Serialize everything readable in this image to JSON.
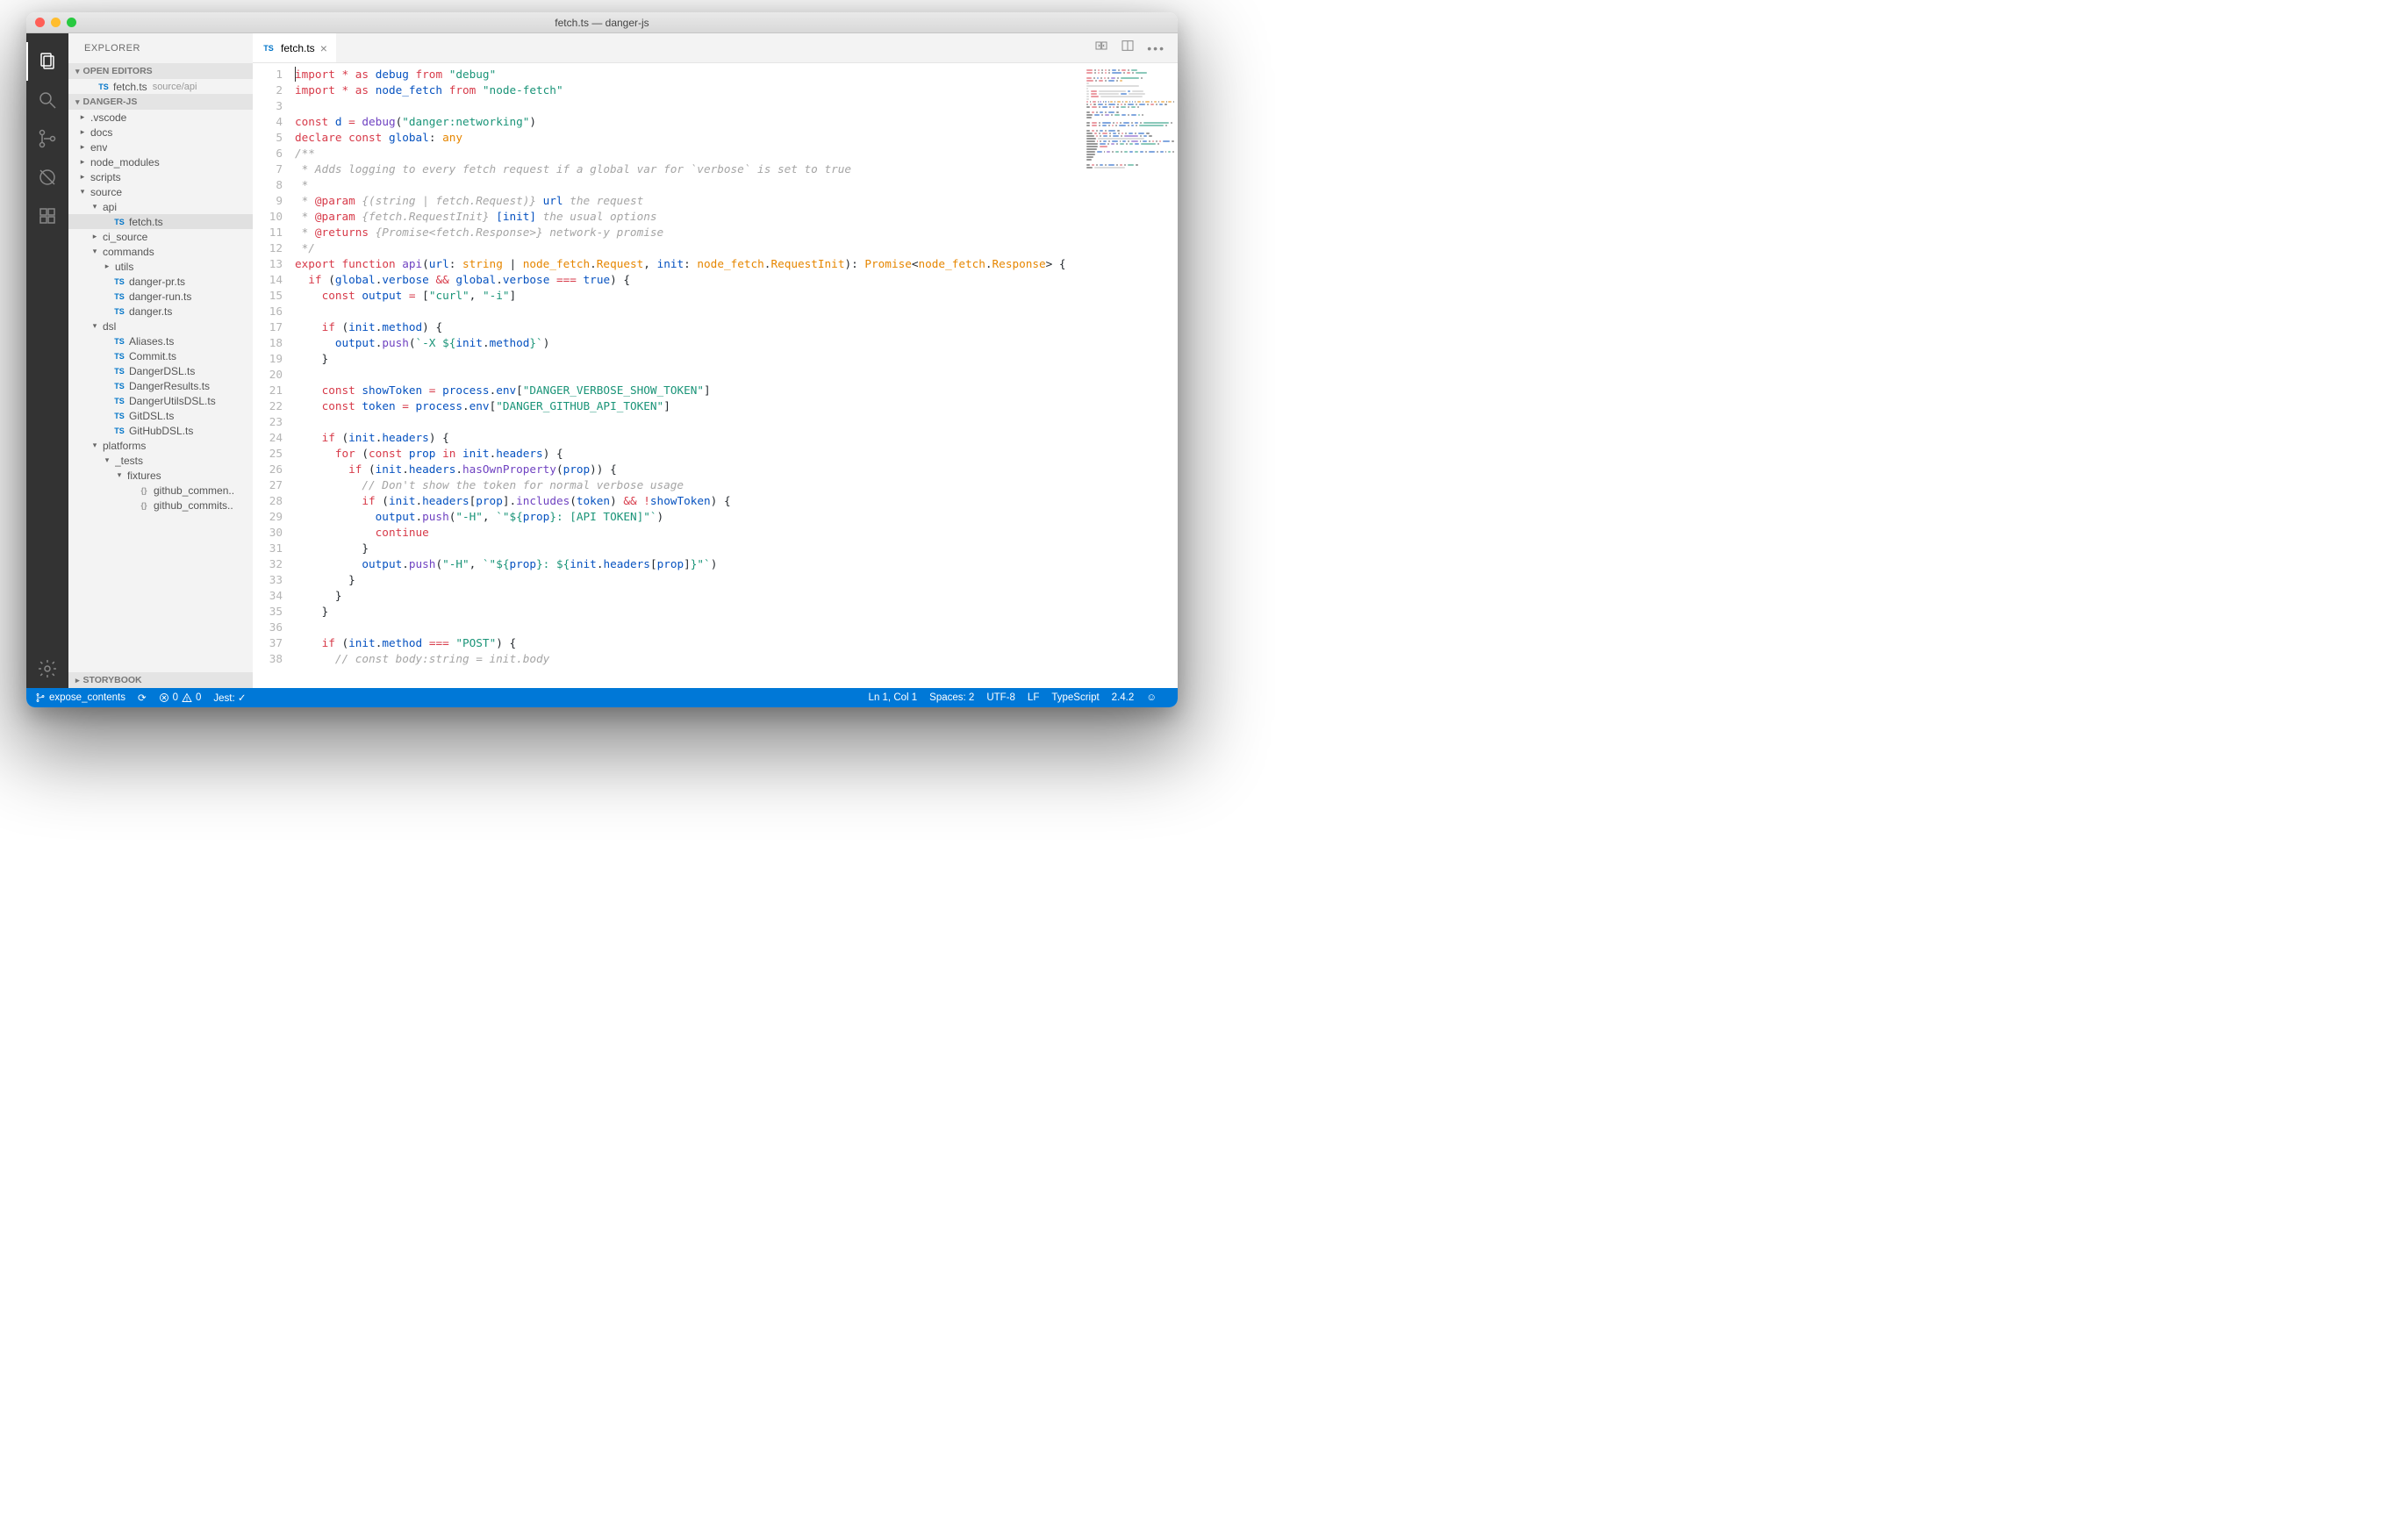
{
  "window_title": "fetch.ts — danger-js",
  "activity_icons": [
    "files",
    "search",
    "git",
    "debug",
    "extensions"
  ],
  "explorer": {
    "title": "EXPLORER",
    "open_editors": {
      "label": "OPEN EDITORS",
      "items": [
        {
          "icon": "TS",
          "name": "fetch.ts",
          "detail": "source/api"
        }
      ]
    },
    "workspace": {
      "label": "DANGER-JS",
      "tree": [
        {
          "d": 0,
          "t": "folder",
          "open": false,
          "name": ".vscode"
        },
        {
          "d": 0,
          "t": "folder",
          "open": false,
          "name": "docs"
        },
        {
          "d": 0,
          "t": "folder",
          "open": false,
          "name": "env"
        },
        {
          "d": 0,
          "t": "folder",
          "open": false,
          "name": "node_modules"
        },
        {
          "d": 0,
          "t": "folder",
          "open": false,
          "name": "scripts"
        },
        {
          "d": 0,
          "t": "folder",
          "open": true,
          "name": "source"
        },
        {
          "d": 1,
          "t": "folder",
          "open": true,
          "name": "api"
        },
        {
          "d": 2,
          "t": "file",
          "icon": "TS",
          "name": "fetch.ts",
          "sel": true
        },
        {
          "d": 1,
          "t": "folder",
          "open": false,
          "name": "ci_source"
        },
        {
          "d": 1,
          "t": "folder",
          "open": true,
          "name": "commands"
        },
        {
          "d": 2,
          "t": "folder",
          "open": false,
          "name": "utils"
        },
        {
          "d": 2,
          "t": "file",
          "icon": "TS",
          "name": "danger-pr.ts"
        },
        {
          "d": 2,
          "t": "file",
          "icon": "TS",
          "name": "danger-run.ts"
        },
        {
          "d": 2,
          "t": "file",
          "icon": "TS",
          "name": "danger.ts"
        },
        {
          "d": 1,
          "t": "folder",
          "open": true,
          "name": "dsl"
        },
        {
          "d": 2,
          "t": "file",
          "icon": "TS",
          "name": "Aliases.ts"
        },
        {
          "d": 2,
          "t": "file",
          "icon": "TS",
          "name": "Commit.ts"
        },
        {
          "d": 2,
          "t": "file",
          "icon": "TS",
          "name": "DangerDSL.ts"
        },
        {
          "d": 2,
          "t": "file",
          "icon": "TS",
          "name": "DangerResults.ts"
        },
        {
          "d": 2,
          "t": "file",
          "icon": "TS",
          "name": "DangerUtilsDSL.ts"
        },
        {
          "d": 2,
          "t": "file",
          "icon": "TS",
          "name": "GitDSL.ts"
        },
        {
          "d": 2,
          "t": "file",
          "icon": "TS",
          "name": "GitHubDSL.ts"
        },
        {
          "d": 1,
          "t": "folder",
          "open": true,
          "name": "platforms"
        },
        {
          "d": 2,
          "t": "folder",
          "open": true,
          "name": "_tests"
        },
        {
          "d": 3,
          "t": "folder",
          "open": true,
          "name": "fixtures"
        },
        {
          "d": 4,
          "t": "file",
          "icon": "{}",
          "name": "github_commen.."
        },
        {
          "d": 4,
          "t": "file",
          "icon": "{}",
          "name": "github_commits.."
        }
      ]
    },
    "storybook_label": "STORYBOOK"
  },
  "tab": {
    "icon": "TS",
    "name": "fetch.ts"
  },
  "code_lines": [
    [
      [
        "k",
        "import"
      ],
      [
        "v",
        " "
      ],
      [
        "o",
        "*"
      ],
      [
        "v",
        " "
      ],
      [
        "k",
        "as"
      ],
      [
        "v",
        " "
      ],
      [
        "p",
        "debug"
      ],
      [
        "v",
        " "
      ],
      [
        "k",
        "from"
      ],
      [
        "v",
        " "
      ],
      [
        "s",
        "\"debug\""
      ]
    ],
    [
      [
        "k",
        "import"
      ],
      [
        "v",
        " "
      ],
      [
        "o",
        "*"
      ],
      [
        "v",
        " "
      ],
      [
        "k",
        "as"
      ],
      [
        "v",
        " "
      ],
      [
        "p",
        "node_fetch"
      ],
      [
        "v",
        " "
      ],
      [
        "k",
        "from"
      ],
      [
        "v",
        " "
      ],
      [
        "s",
        "\"node-fetch\""
      ]
    ],
    [],
    [
      [
        "k",
        "const"
      ],
      [
        "v",
        " "
      ],
      [
        "p",
        "d"
      ],
      [
        "v",
        " "
      ],
      [
        "o",
        "="
      ],
      [
        "v",
        " "
      ],
      [
        "f",
        "debug"
      ],
      [
        "v",
        "("
      ],
      [
        "s",
        "\"danger:networking\""
      ],
      [
        "v",
        ")"
      ]
    ],
    [
      [
        "k",
        "declare"
      ],
      [
        "v",
        " "
      ],
      [
        "k",
        "const"
      ],
      [
        "v",
        " "
      ],
      [
        "p",
        "global"
      ],
      [
        "v",
        ": "
      ],
      [
        "t",
        "any"
      ]
    ],
    [
      [
        "c",
        "/**"
      ]
    ],
    [
      [
        "c",
        " * Adds logging to every fetch request if a global var for `verbose` is set to true"
      ]
    ],
    [
      [
        "c",
        " *"
      ]
    ],
    [
      [
        "c",
        " * "
      ],
      [
        "tag",
        "@param"
      ],
      [
        "c",
        " {(string | fetch.Request)} "
      ],
      [
        "p",
        "url"
      ],
      [
        "c",
        " the request"
      ]
    ],
    [
      [
        "c",
        " * "
      ],
      [
        "tag",
        "@param"
      ],
      [
        "c",
        " {fetch.RequestInit} "
      ],
      [
        "p",
        "[init]"
      ],
      [
        "c",
        " the usual options"
      ]
    ],
    [
      [
        "c",
        " * "
      ],
      [
        "tag",
        "@returns"
      ],
      [
        "c",
        " {Promise<fetch.Response>} network-y promise"
      ]
    ],
    [
      [
        "c",
        " */"
      ]
    ],
    [
      [
        "k",
        "export"
      ],
      [
        "v",
        " "
      ],
      [
        "k",
        "function"
      ],
      [
        "v",
        " "
      ],
      [
        "f",
        "api"
      ],
      [
        "v",
        "("
      ],
      [
        "p",
        "url"
      ],
      [
        "v",
        ": "
      ],
      [
        "t",
        "string"
      ],
      [
        "v",
        " | "
      ],
      [
        "t",
        "node_fetch"
      ],
      [
        "v",
        "."
      ],
      [
        "t",
        "Request"
      ],
      [
        "v",
        ", "
      ],
      [
        "p",
        "init"
      ],
      [
        "v",
        ": "
      ],
      [
        "t",
        "node_fetch"
      ],
      [
        "v",
        "."
      ],
      [
        "t",
        "RequestInit"
      ],
      [
        "v",
        "): "
      ],
      [
        "t",
        "Promise"
      ],
      [
        "v",
        "<"
      ],
      [
        "t",
        "node_fetch"
      ],
      [
        "v",
        "."
      ],
      [
        "t",
        "Response"
      ],
      [
        "v",
        "> {"
      ]
    ],
    [
      [
        "v",
        "  "
      ],
      [
        "k",
        "if"
      ],
      [
        "v",
        " ("
      ],
      [
        "p",
        "global"
      ],
      [
        "v",
        "."
      ],
      [
        "p",
        "verbose"
      ],
      [
        "v",
        " "
      ],
      [
        "o",
        "&&"
      ],
      [
        "v",
        " "
      ],
      [
        "p",
        "global"
      ],
      [
        "v",
        "."
      ],
      [
        "p",
        "verbose"
      ],
      [
        "v",
        " "
      ],
      [
        "o",
        "==="
      ],
      [
        "v",
        " "
      ],
      [
        "p",
        "true"
      ],
      [
        "v",
        ") {"
      ]
    ],
    [
      [
        "v",
        "    "
      ],
      [
        "k",
        "const"
      ],
      [
        "v",
        " "
      ],
      [
        "p",
        "output"
      ],
      [
        "v",
        " "
      ],
      [
        "o",
        "="
      ],
      [
        "v",
        " ["
      ],
      [
        "s",
        "\"curl\""
      ],
      [
        "v",
        ", "
      ],
      [
        "s",
        "\"-i\""
      ],
      [
        "v",
        "]"
      ]
    ],
    [],
    [
      [
        "v",
        "    "
      ],
      [
        "k",
        "if"
      ],
      [
        "v",
        " ("
      ],
      [
        "p",
        "init"
      ],
      [
        "v",
        "."
      ],
      [
        "p",
        "method"
      ],
      [
        "v",
        ") {"
      ]
    ],
    [
      [
        "v",
        "      "
      ],
      [
        "p",
        "output"
      ],
      [
        "v",
        "."
      ],
      [
        "f",
        "push"
      ],
      [
        "v",
        "("
      ],
      [
        "s",
        "`-X ${"
      ],
      [
        "p",
        "init"
      ],
      [
        "v",
        "."
      ],
      [
        "p",
        "method"
      ],
      [
        "s",
        "}`"
      ],
      [
        "v",
        ")"
      ]
    ],
    [
      [
        "v",
        "    }"
      ]
    ],
    [],
    [
      [
        "v",
        "    "
      ],
      [
        "k",
        "const"
      ],
      [
        "v",
        " "
      ],
      [
        "p",
        "showToken"
      ],
      [
        "v",
        " "
      ],
      [
        "o",
        "="
      ],
      [
        "v",
        " "
      ],
      [
        "p",
        "process"
      ],
      [
        "v",
        "."
      ],
      [
        "p",
        "env"
      ],
      [
        "v",
        "["
      ],
      [
        "s",
        "\"DANGER_VERBOSE_SHOW_TOKEN\""
      ],
      [
        "v",
        "]"
      ]
    ],
    [
      [
        "v",
        "    "
      ],
      [
        "k",
        "const"
      ],
      [
        "v",
        " "
      ],
      [
        "p",
        "token"
      ],
      [
        "v",
        " "
      ],
      [
        "o",
        "="
      ],
      [
        "v",
        " "
      ],
      [
        "p",
        "process"
      ],
      [
        "v",
        "."
      ],
      [
        "p",
        "env"
      ],
      [
        "v",
        "["
      ],
      [
        "s",
        "\"DANGER_GITHUB_API_TOKEN\""
      ],
      [
        "v",
        "]"
      ]
    ],
    [],
    [
      [
        "v",
        "    "
      ],
      [
        "k",
        "if"
      ],
      [
        "v",
        " ("
      ],
      [
        "p",
        "init"
      ],
      [
        "v",
        "."
      ],
      [
        "p",
        "headers"
      ],
      [
        "v",
        ") {"
      ]
    ],
    [
      [
        "v",
        "      "
      ],
      [
        "k",
        "for"
      ],
      [
        "v",
        " ("
      ],
      [
        "k",
        "const"
      ],
      [
        "v",
        " "
      ],
      [
        "p",
        "prop"
      ],
      [
        "v",
        " "
      ],
      [
        "k",
        "in"
      ],
      [
        "v",
        " "
      ],
      [
        "p",
        "init"
      ],
      [
        "v",
        "."
      ],
      [
        "p",
        "headers"
      ],
      [
        "v",
        ") {"
      ]
    ],
    [
      [
        "v",
        "        "
      ],
      [
        "k",
        "if"
      ],
      [
        "v",
        " ("
      ],
      [
        "p",
        "init"
      ],
      [
        "v",
        "."
      ],
      [
        "p",
        "headers"
      ],
      [
        "v",
        "."
      ],
      [
        "f",
        "hasOwnProperty"
      ],
      [
        "v",
        "("
      ],
      [
        "p",
        "prop"
      ],
      [
        "v",
        ")) {"
      ]
    ],
    [
      [
        "v",
        "          "
      ],
      [
        "c",
        "// Don't show the token for normal verbose usage"
      ]
    ],
    [
      [
        "v",
        "          "
      ],
      [
        "k",
        "if"
      ],
      [
        "v",
        " ("
      ],
      [
        "p",
        "init"
      ],
      [
        "v",
        "."
      ],
      [
        "p",
        "headers"
      ],
      [
        "v",
        "["
      ],
      [
        "p",
        "prop"
      ],
      [
        "v",
        "]."
      ],
      [
        "f",
        "includes"
      ],
      [
        "v",
        "("
      ],
      [
        "p",
        "token"
      ],
      [
        "v",
        ") "
      ],
      [
        "o",
        "&&"
      ],
      [
        "v",
        " "
      ],
      [
        "o",
        "!"
      ],
      [
        "p",
        "showToken"
      ],
      [
        "v",
        ") {"
      ]
    ],
    [
      [
        "v",
        "            "
      ],
      [
        "p",
        "output"
      ],
      [
        "v",
        "."
      ],
      [
        "f",
        "push"
      ],
      [
        "v",
        "("
      ],
      [
        "s",
        "\"-H\""
      ],
      [
        "v",
        ", "
      ],
      [
        "s",
        "`\"${"
      ],
      [
        "p",
        "prop"
      ],
      [
        "s",
        "}: [API TOKEN]\"`"
      ],
      [
        "v",
        ")"
      ]
    ],
    [
      [
        "v",
        "            "
      ],
      [
        "k",
        "continue"
      ]
    ],
    [
      [
        "v",
        "          }"
      ]
    ],
    [
      [
        "v",
        "          "
      ],
      [
        "p",
        "output"
      ],
      [
        "v",
        "."
      ],
      [
        "f",
        "push"
      ],
      [
        "v",
        "("
      ],
      [
        "s",
        "\"-H\""
      ],
      [
        "v",
        ", "
      ],
      [
        "s",
        "`\"${"
      ],
      [
        "p",
        "prop"
      ],
      [
        "s",
        "}: ${"
      ],
      [
        "p",
        "init"
      ],
      [
        "v",
        "."
      ],
      [
        "p",
        "headers"
      ],
      [
        "v",
        "["
      ],
      [
        "p",
        "prop"
      ],
      [
        "v",
        "]"
      ],
      [
        "s",
        "}\"`"
      ],
      [
        "v",
        ")"
      ]
    ],
    [
      [
        "v",
        "        }"
      ]
    ],
    [
      [
        "v",
        "      }"
      ]
    ],
    [
      [
        "v",
        "    }"
      ]
    ],
    [],
    [
      [
        "v",
        "    "
      ],
      [
        "k",
        "if"
      ],
      [
        "v",
        " ("
      ],
      [
        "p",
        "init"
      ],
      [
        "v",
        "."
      ],
      [
        "p",
        "method"
      ],
      [
        "v",
        " "
      ],
      [
        "o",
        "==="
      ],
      [
        "v",
        " "
      ],
      [
        "s",
        "\"POST\""
      ],
      [
        "v",
        ") {"
      ]
    ],
    [
      [
        "v",
        "      "
      ],
      [
        "c",
        "// const body:string = init.body"
      ]
    ]
  ],
  "status": {
    "branch": "expose_contents",
    "sync": "⟳",
    "errors": "0",
    "warnings": "0",
    "jest": "Jest: ✓",
    "pos": "Ln 1, Col 1",
    "spaces": "Spaces: 2",
    "encoding": "UTF-8",
    "eol": "LF",
    "lang": "TypeScript",
    "ver": "2.4.2",
    "smiley": "☺"
  }
}
